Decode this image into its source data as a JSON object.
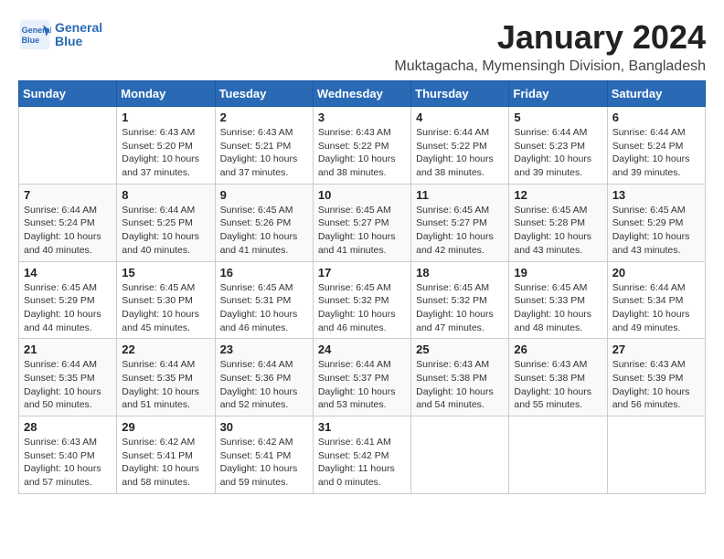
{
  "header": {
    "logo_line1": "General",
    "logo_line2": "Blue",
    "title": "January 2024",
    "subtitle": "Muktagacha, Mymensingh Division, Bangladesh"
  },
  "columns": [
    "Sunday",
    "Monday",
    "Tuesday",
    "Wednesday",
    "Thursday",
    "Friday",
    "Saturday"
  ],
  "weeks": [
    [
      {
        "day": "",
        "info": ""
      },
      {
        "day": "1",
        "info": "Sunrise: 6:43 AM\nSunset: 5:20 PM\nDaylight: 10 hours\nand 37 minutes."
      },
      {
        "day": "2",
        "info": "Sunrise: 6:43 AM\nSunset: 5:21 PM\nDaylight: 10 hours\nand 37 minutes."
      },
      {
        "day": "3",
        "info": "Sunrise: 6:43 AM\nSunset: 5:22 PM\nDaylight: 10 hours\nand 38 minutes."
      },
      {
        "day": "4",
        "info": "Sunrise: 6:44 AM\nSunset: 5:22 PM\nDaylight: 10 hours\nand 38 minutes."
      },
      {
        "day": "5",
        "info": "Sunrise: 6:44 AM\nSunset: 5:23 PM\nDaylight: 10 hours\nand 39 minutes."
      },
      {
        "day": "6",
        "info": "Sunrise: 6:44 AM\nSunset: 5:24 PM\nDaylight: 10 hours\nand 39 minutes."
      }
    ],
    [
      {
        "day": "7",
        "info": "Sunrise: 6:44 AM\nSunset: 5:24 PM\nDaylight: 10 hours\nand 40 minutes."
      },
      {
        "day": "8",
        "info": "Sunrise: 6:44 AM\nSunset: 5:25 PM\nDaylight: 10 hours\nand 40 minutes."
      },
      {
        "day": "9",
        "info": "Sunrise: 6:45 AM\nSunset: 5:26 PM\nDaylight: 10 hours\nand 41 minutes."
      },
      {
        "day": "10",
        "info": "Sunrise: 6:45 AM\nSunset: 5:27 PM\nDaylight: 10 hours\nand 41 minutes."
      },
      {
        "day": "11",
        "info": "Sunrise: 6:45 AM\nSunset: 5:27 PM\nDaylight: 10 hours\nand 42 minutes."
      },
      {
        "day": "12",
        "info": "Sunrise: 6:45 AM\nSunset: 5:28 PM\nDaylight: 10 hours\nand 43 minutes."
      },
      {
        "day": "13",
        "info": "Sunrise: 6:45 AM\nSunset: 5:29 PM\nDaylight: 10 hours\nand 43 minutes."
      }
    ],
    [
      {
        "day": "14",
        "info": "Sunrise: 6:45 AM\nSunset: 5:29 PM\nDaylight: 10 hours\nand 44 minutes."
      },
      {
        "day": "15",
        "info": "Sunrise: 6:45 AM\nSunset: 5:30 PM\nDaylight: 10 hours\nand 45 minutes."
      },
      {
        "day": "16",
        "info": "Sunrise: 6:45 AM\nSunset: 5:31 PM\nDaylight: 10 hours\nand 46 minutes."
      },
      {
        "day": "17",
        "info": "Sunrise: 6:45 AM\nSunset: 5:32 PM\nDaylight: 10 hours\nand 46 minutes."
      },
      {
        "day": "18",
        "info": "Sunrise: 6:45 AM\nSunset: 5:32 PM\nDaylight: 10 hours\nand 47 minutes."
      },
      {
        "day": "19",
        "info": "Sunrise: 6:45 AM\nSunset: 5:33 PM\nDaylight: 10 hours\nand 48 minutes."
      },
      {
        "day": "20",
        "info": "Sunrise: 6:44 AM\nSunset: 5:34 PM\nDaylight: 10 hours\nand 49 minutes."
      }
    ],
    [
      {
        "day": "21",
        "info": "Sunrise: 6:44 AM\nSunset: 5:35 PM\nDaylight: 10 hours\nand 50 minutes."
      },
      {
        "day": "22",
        "info": "Sunrise: 6:44 AM\nSunset: 5:35 PM\nDaylight: 10 hours\nand 51 minutes."
      },
      {
        "day": "23",
        "info": "Sunrise: 6:44 AM\nSunset: 5:36 PM\nDaylight: 10 hours\nand 52 minutes."
      },
      {
        "day": "24",
        "info": "Sunrise: 6:44 AM\nSunset: 5:37 PM\nDaylight: 10 hours\nand 53 minutes."
      },
      {
        "day": "25",
        "info": "Sunrise: 6:43 AM\nSunset: 5:38 PM\nDaylight: 10 hours\nand 54 minutes."
      },
      {
        "day": "26",
        "info": "Sunrise: 6:43 AM\nSunset: 5:38 PM\nDaylight: 10 hours\nand 55 minutes."
      },
      {
        "day": "27",
        "info": "Sunrise: 6:43 AM\nSunset: 5:39 PM\nDaylight: 10 hours\nand 56 minutes."
      }
    ],
    [
      {
        "day": "28",
        "info": "Sunrise: 6:43 AM\nSunset: 5:40 PM\nDaylight: 10 hours\nand 57 minutes."
      },
      {
        "day": "29",
        "info": "Sunrise: 6:42 AM\nSunset: 5:41 PM\nDaylight: 10 hours\nand 58 minutes."
      },
      {
        "day": "30",
        "info": "Sunrise: 6:42 AM\nSunset: 5:41 PM\nDaylight: 10 hours\nand 59 minutes."
      },
      {
        "day": "31",
        "info": "Sunrise: 6:41 AM\nSunset: 5:42 PM\nDaylight: 11 hours\nand 0 minutes."
      },
      {
        "day": "",
        "info": ""
      },
      {
        "day": "",
        "info": ""
      },
      {
        "day": "",
        "info": ""
      }
    ]
  ]
}
